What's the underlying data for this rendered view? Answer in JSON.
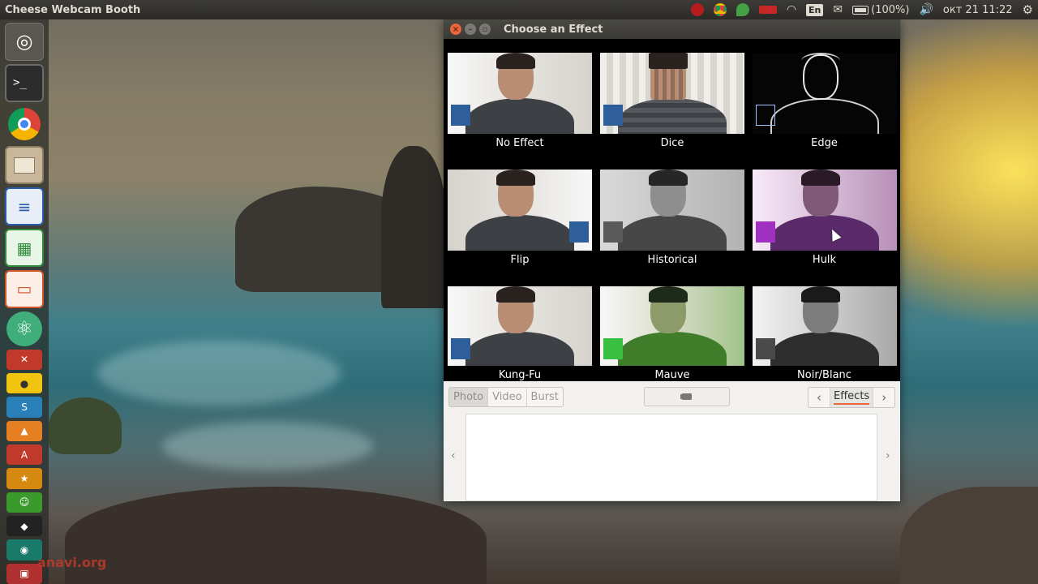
{
  "top_panel": {
    "app_title": "Cheese Webcam Booth",
    "keyboard_layout": "En",
    "battery": "(100%)",
    "datetime": "окт 21 11:22"
  },
  "launcher": {
    "items": [
      "ubuntu-dash",
      "terminal",
      "chrome",
      "files",
      "writer",
      "calc",
      "impress",
      "atom"
    ]
  },
  "window": {
    "title": "Choose an Effect",
    "effects": [
      {
        "label": "No Effect"
      },
      {
        "label": "Dice"
      },
      {
        "label": "Edge"
      },
      {
        "label": "Flip"
      },
      {
        "label": "Historical"
      },
      {
        "label": "Hulk"
      },
      {
        "label": "Kung-Fu"
      },
      {
        "label": "Mauve"
      },
      {
        "label": "Noir/Blanc"
      }
    ],
    "toolbar": {
      "modes": [
        "Photo",
        "Video",
        "Burst"
      ],
      "active_mode": "Photo",
      "effects_label": "Effects"
    }
  },
  "watermark": "anavi.org"
}
